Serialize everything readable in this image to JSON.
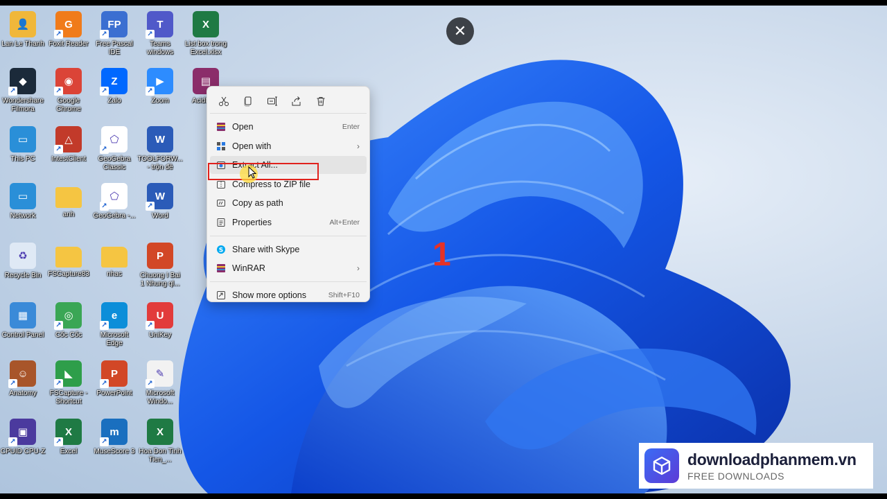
{
  "desktop_icons": [
    {
      "label": "Lan Le Thanh",
      "icon": "user-folder-icon",
      "color": "#f0b73a"
    },
    {
      "label": "Foxit Reader",
      "icon": "pdf-reader-icon",
      "color": "#f07b1a"
    },
    {
      "label": "Free Pascal IDE",
      "icon": "pascal-ide-icon",
      "color": "#3b6fd1"
    },
    {
      "label": "Teams windows",
      "icon": "teams-icon",
      "color": "#5059c9"
    },
    {
      "label": "List box trong Excel.xlsx",
      "icon": "excel-file-icon",
      "color": "#1f7a44"
    },
    {
      "label": "Wondershare Filmora",
      "icon": "filmora-icon",
      "color": "#1b2a3a"
    },
    {
      "label": "Google Chrome",
      "icon": "chrome-icon",
      "color": "#db4437"
    },
    {
      "label": "Zalo",
      "icon": "zalo-icon",
      "color": "#0068ff"
    },
    {
      "label": "Zoom",
      "icon": "zoom-icon",
      "color": "#2d8cff"
    },
    {
      "label": "AcidHelp",
      "icon": "winrar-archive-icon",
      "color": "#8b2d6a"
    },
    {
      "label": "This PC",
      "icon": "monitor-icon",
      "color": "#2a8fd8"
    },
    {
      "label": "IntestClient",
      "icon": "intest-icon",
      "color": "#c23a2a"
    },
    {
      "label": "GeoGebra Classic",
      "icon": "geogebra-icon",
      "color": "#ffffff"
    },
    {
      "label": "TOOLFORW... - trộn đề",
      "icon": "word-file-icon",
      "color": "#2b5bb8"
    },
    {
      "label": "Network",
      "icon": "network-icon",
      "color": "#2a8fd8"
    },
    {
      "label": "anh",
      "icon": "folder-icon",
      "color": "#f5c542"
    },
    {
      "label": "GeoGebra -...",
      "icon": "geogebra-icon",
      "color": "#ffffff"
    },
    {
      "label": "Word",
      "icon": "word-icon",
      "color": "#2b5bb8"
    },
    {
      "label": "Recycle Bin",
      "icon": "recycle-bin-icon",
      "color": "#dfe9f5"
    },
    {
      "label": "FSCapture83",
      "icon": "folder-icon",
      "color": "#f5c542"
    },
    {
      "label": "nhac",
      "icon": "folder-icon",
      "color": "#f5c542"
    },
    {
      "label": "Chuong I Bai 1 Nhung ql...",
      "icon": "powerpoint-file-icon",
      "color": "#d24726"
    },
    {
      "label": "Control Panel",
      "icon": "control-panel-icon",
      "color": "#3a8ad8"
    },
    {
      "label": "Cốc Cốc",
      "icon": "coccoc-icon",
      "color": "#3aa655"
    },
    {
      "label": "Microsoft Edge",
      "icon": "edge-icon",
      "color": "#0c8ed9"
    },
    {
      "label": "UniKey",
      "icon": "unikey-icon",
      "color": "#e23b3b"
    },
    {
      "label": "Anatomy",
      "icon": "anatomy-icon",
      "color": "#a8552a"
    },
    {
      "label": "FSCapture - Shortcut",
      "icon": "fscapture-icon",
      "color": "#2e9e4a"
    },
    {
      "label": "PowerPoint",
      "icon": "powerpoint-icon",
      "color": "#d24726"
    },
    {
      "label": "Microsoft Windo...",
      "icon": "whiteboard-icon",
      "color": "#f2f2f2"
    },
    {
      "label": "CPUID CPU-Z",
      "icon": "cpuz-icon",
      "color": "#4b3a9e"
    },
    {
      "label": "Excel",
      "icon": "excel-icon",
      "color": "#1f7a44"
    },
    {
      "label": "MuseScore 3",
      "icon": "musescore-icon",
      "color": "#1a6fbf"
    },
    {
      "label": "Hoa Don Tinh Tien_...",
      "icon": "excel-file-icon",
      "color": "#1f7a44"
    }
  ],
  "toolbar_icons": [
    "cut-icon",
    "copy-icon",
    "rename-icon",
    "share-icon",
    "delete-icon"
  ],
  "context_menu": {
    "items": [
      {
        "id": "open",
        "label": "Open",
        "shortcut": "Enter",
        "icon": "winrar-icon",
        "submenu": false
      },
      {
        "id": "open-with",
        "label": "Open with",
        "shortcut": "",
        "icon": "open-with-icon",
        "submenu": true
      },
      {
        "id": "extract-all",
        "label": "Extract All...",
        "shortcut": "",
        "icon": "extract-icon",
        "submenu": false
      },
      {
        "id": "compress-zip",
        "label": "Compress to ZIP file",
        "shortcut": "",
        "icon": "zip-icon",
        "submenu": false
      },
      {
        "id": "copy-path",
        "label": "Copy as path",
        "shortcut": "",
        "icon": "copy-path-icon",
        "submenu": false
      },
      {
        "id": "properties",
        "label": "Properties",
        "shortcut": "Alt+Enter",
        "icon": "properties-icon",
        "submenu": false
      },
      {
        "id": "share-skype",
        "label": "Share with Skype",
        "shortcut": "",
        "icon": "skype-icon",
        "submenu": false
      },
      {
        "id": "winrar",
        "label": "WinRAR",
        "shortcut": "",
        "icon": "winrar-icon",
        "submenu": true
      },
      {
        "id": "show-more",
        "label": "Show more options",
        "shortcut": "Shift+F10",
        "icon": "show-more-icon",
        "submenu": false
      }
    ]
  },
  "annotation": {
    "step_number": "1",
    "highlight_color": "#e0211c"
  },
  "close_button": {
    "glyph": "✕"
  },
  "watermark": {
    "title": "downloadphanmem.vn",
    "subtitle": "FREE DOWNLOADS"
  }
}
